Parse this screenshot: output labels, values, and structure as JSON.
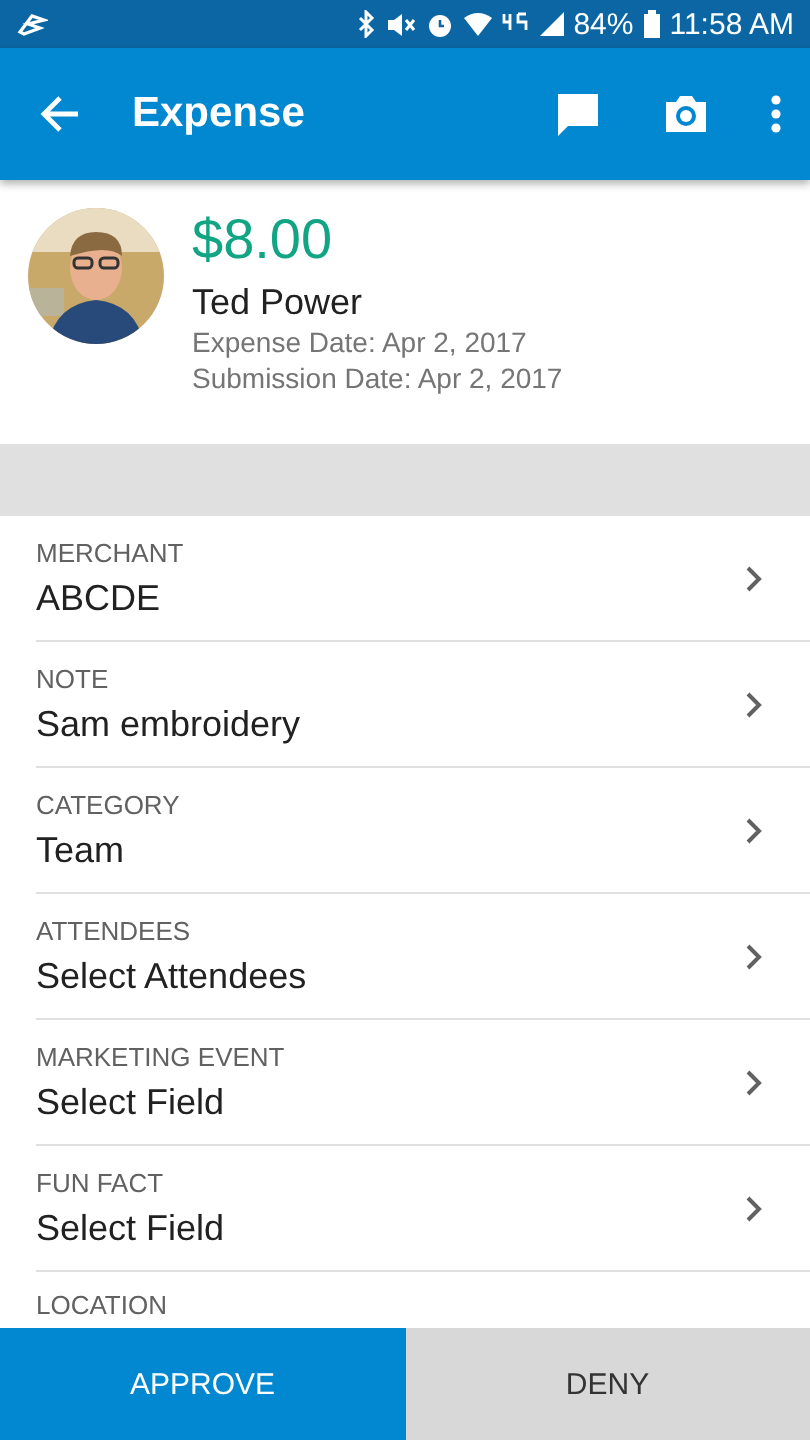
{
  "status_bar": {
    "battery": "84%",
    "time": "11:58 AM"
  },
  "app_bar": {
    "title": "Expense"
  },
  "expense": {
    "amount": "$8.00",
    "name": "Ted Power",
    "expense_date": "Expense Date: Apr 2, 2017",
    "submission_date": "Submission Date: Apr 2, 2017"
  },
  "fields": [
    {
      "label": "MERCHANT",
      "value": "ABCDE"
    },
    {
      "label": "NOTE",
      "value": "Sam embroidery"
    },
    {
      "label": "CATEGORY",
      "value": "Team"
    },
    {
      "label": "ATTENDEES",
      "value": "Select Attendees"
    },
    {
      "label": "MARKETING EVENT",
      "value": "Select Field"
    },
    {
      "label": "FUN FACT",
      "value": "Select Field"
    },
    {
      "label": "LOCATION"
    }
  ],
  "actions": [
    {
      "label": "APPROVE",
      "kind": "primary"
    },
    {
      "label": "DENY",
      "kind": "secondary"
    }
  ]
}
